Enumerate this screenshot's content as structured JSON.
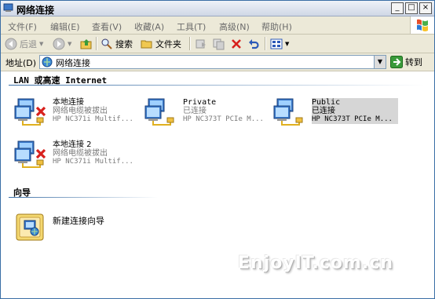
{
  "window": {
    "title": "网络连接"
  },
  "title_buttons": [
    "_",
    "□",
    "×"
  ],
  "menu": [
    "文件(F)",
    "编辑(E)",
    "查看(V)",
    "收藏(A)",
    "工具(T)",
    "高级(N)",
    "帮助(H)"
  ],
  "toolbar": {
    "back": "后退",
    "search": "搜索",
    "folders": "文件夹"
  },
  "address": {
    "label": "地址(D)",
    "value": "网络连接",
    "go": "转到"
  },
  "groups": {
    "lan": "LAN 或高速 Internet",
    "wizard": "向导"
  },
  "connections": [
    {
      "name": "本地连接",
      "status": "网络电缆被拔出",
      "device": "HP NC371i Multif...",
      "disconnected": true
    },
    {
      "name": "Private",
      "status": "已连接",
      "device": "HP NC373T PCIe M...",
      "disconnected": false
    },
    {
      "name": "Public",
      "status": "已连接",
      "device": "HP NC373T PCIe M...",
      "disconnected": false,
      "selected": true
    },
    {
      "name": "本地连接 2",
      "status": "网络电缆被拔出",
      "device": "HP NC371i Multif...",
      "disconnected": true
    }
  ],
  "wizard_items": [
    {
      "name": "新建连接向导"
    }
  ],
  "watermark": "EnjoyIT.com.cn",
  "colors": {
    "title_blue": "#3a6ea5",
    "chrome": "#ece9d8",
    "error_red": "#d8201c",
    "go_green": "#3a9a3a"
  }
}
